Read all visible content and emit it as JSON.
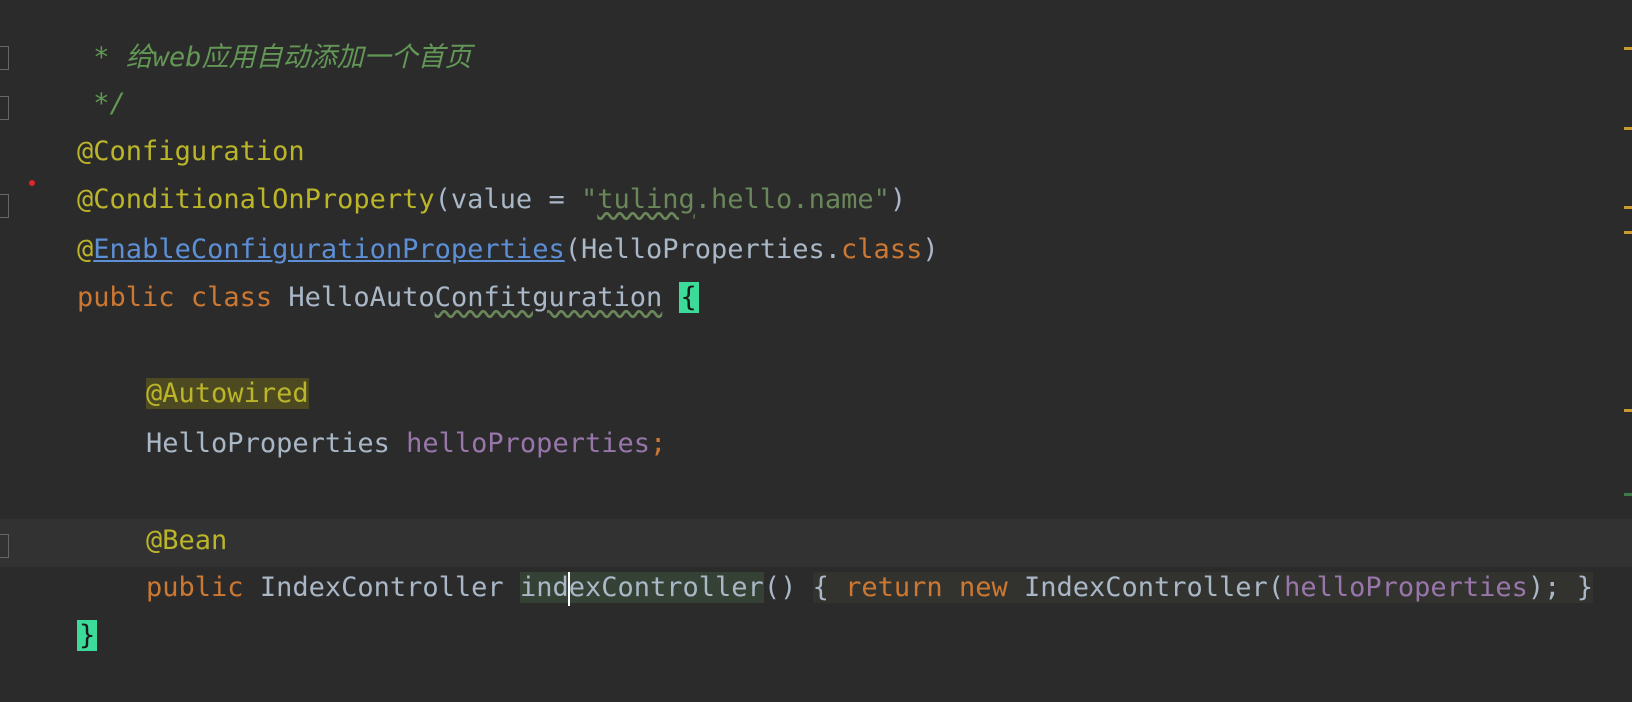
{
  "code": {
    "comment_line": " * 给web应用自动添加一个首页",
    "comment_end": " */",
    "anno_configuration": "@Configuration",
    "anno_conditional": "@ConditionalOnProperty",
    "cond_open": "(value = ",
    "cond_quote_open": "\"",
    "cond_value": "tuling",
    "cond_value_rest": ".hello.name",
    "cond_quote_close": "\"",
    "cond_close": ")",
    "anno_enable_at": "@",
    "anno_enable_name": "EnableConfigurationProperties",
    "enable_args": "(HelloProperties.",
    "enable_class_kw": "class",
    "enable_close": ")",
    "class_public": "public",
    "class_kw": "class",
    "class_name_a": "HelloAuto",
    "class_name_b": "Confitguration",
    "class_open_brace": "{",
    "anno_autowired": "@Autowired",
    "field_type": "HelloProperties",
    "field_name": "helloProperties",
    "field_semicolon": ";",
    "anno_bean": "@Bean",
    "method_public": "public",
    "method_type": "IndexController",
    "method_name_a": "ind",
    "method_name_b": "exController",
    "method_parens": "()",
    "method_open": "{",
    "method_return": "return",
    "method_new": "new",
    "method_ctor": "IndexController(",
    "method_arg": "helloProperties",
    "method_ctor_close": ");",
    "method_close": "}",
    "class_close_brace": "}"
  },
  "colors": {
    "background": "#2b2b2b",
    "comment": "#629755",
    "annotation": "#bbb529",
    "keyword": "#cc7832",
    "string": "#6a8759",
    "field": "#9876aa",
    "text": "#a9b7c6",
    "brace_highlight": "#3ddb9a"
  }
}
